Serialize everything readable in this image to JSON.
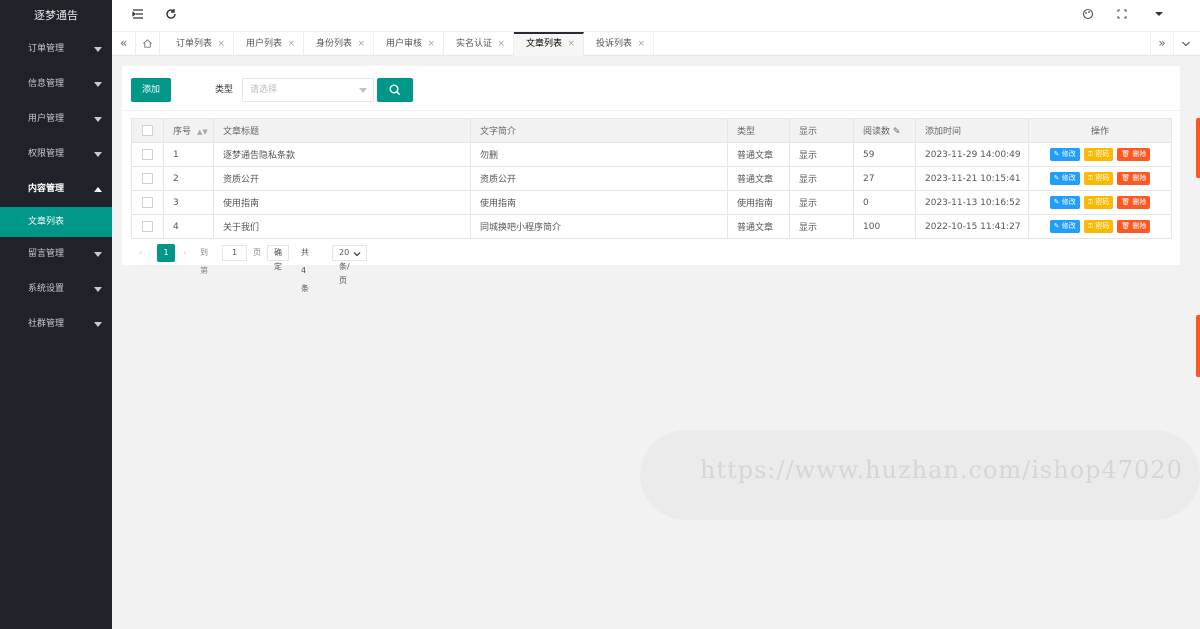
{
  "sidebar": {
    "title": "逐梦通告",
    "items": [
      {
        "label": "订单管理"
      },
      {
        "label": "信息管理"
      },
      {
        "label": "用户管理"
      },
      {
        "label": "权限管理"
      },
      {
        "label": "内容管理"
      },
      {
        "label": "留言管理"
      },
      {
        "label": "系统设置"
      },
      {
        "label": "社群管理"
      }
    ],
    "active_sub": "文章列表"
  },
  "header": {
    "icons": [
      "menu-fold-icon",
      "refresh-icon",
      "theme-icon",
      "fullscreen-icon",
      "more-icon"
    ]
  },
  "tabs": {
    "items": [
      {
        "label": "订单列表"
      },
      {
        "label": "用户列表"
      },
      {
        "label": "身份列表"
      },
      {
        "label": "用户审核"
      },
      {
        "label": "实名认证"
      },
      {
        "label": "文章列表",
        "active": true
      },
      {
        "label": "投诉列表"
      }
    ],
    "close_glyph": "×"
  },
  "toolbar": {
    "add_label": "添加",
    "type_label": "类型",
    "type_placeholder": "请选择"
  },
  "table": {
    "headers": {
      "seq": "序号",
      "title": "文章标题",
      "intro": "文字简介",
      "type": "类型",
      "show": "显示",
      "reads": "阅读数",
      "time": "添加时间",
      "ops": "操作"
    },
    "rows": [
      {
        "seq": "1",
        "title": "逐梦通告隐私条款",
        "intro": "勿删",
        "type": "普通文章",
        "show": "显示",
        "reads": "59",
        "time": "2023-11-29 14:00:49"
      },
      {
        "seq": "2",
        "title": "资质公开",
        "intro": "资质公开",
        "type": "普通文章",
        "show": "显示",
        "reads": "27",
        "time": "2023-11-21 10:15:41"
      },
      {
        "seq": "3",
        "title": "使用指南",
        "intro": "使用指南",
        "type": "使用指南",
        "show": "显示",
        "reads": "0",
        "time": "2023-11-13 10:16:52"
      },
      {
        "seq": "4",
        "title": "关于我们",
        "intro": "同城换吧小程序简介",
        "type": "普通文章",
        "show": "显示",
        "reads": "100",
        "time": "2022-10-15 11:41:27"
      }
    ],
    "ops": {
      "edit": "修改",
      "pwd": "密码",
      "del": "删除"
    }
  },
  "pager": {
    "current": "1",
    "goto_label": "到第",
    "goto_value": "1",
    "page_unit": "页",
    "confirm": "确定",
    "total": "共 4 条",
    "page_size": "20 条/页"
  },
  "watermark": "https://www.huzhan.com/ishop47020",
  "colors": {
    "primary": "#009688",
    "sidebar": "#20222a",
    "edit": "#1e9fff",
    "pwd": "#ffb800",
    "del": "#ff5722"
  }
}
